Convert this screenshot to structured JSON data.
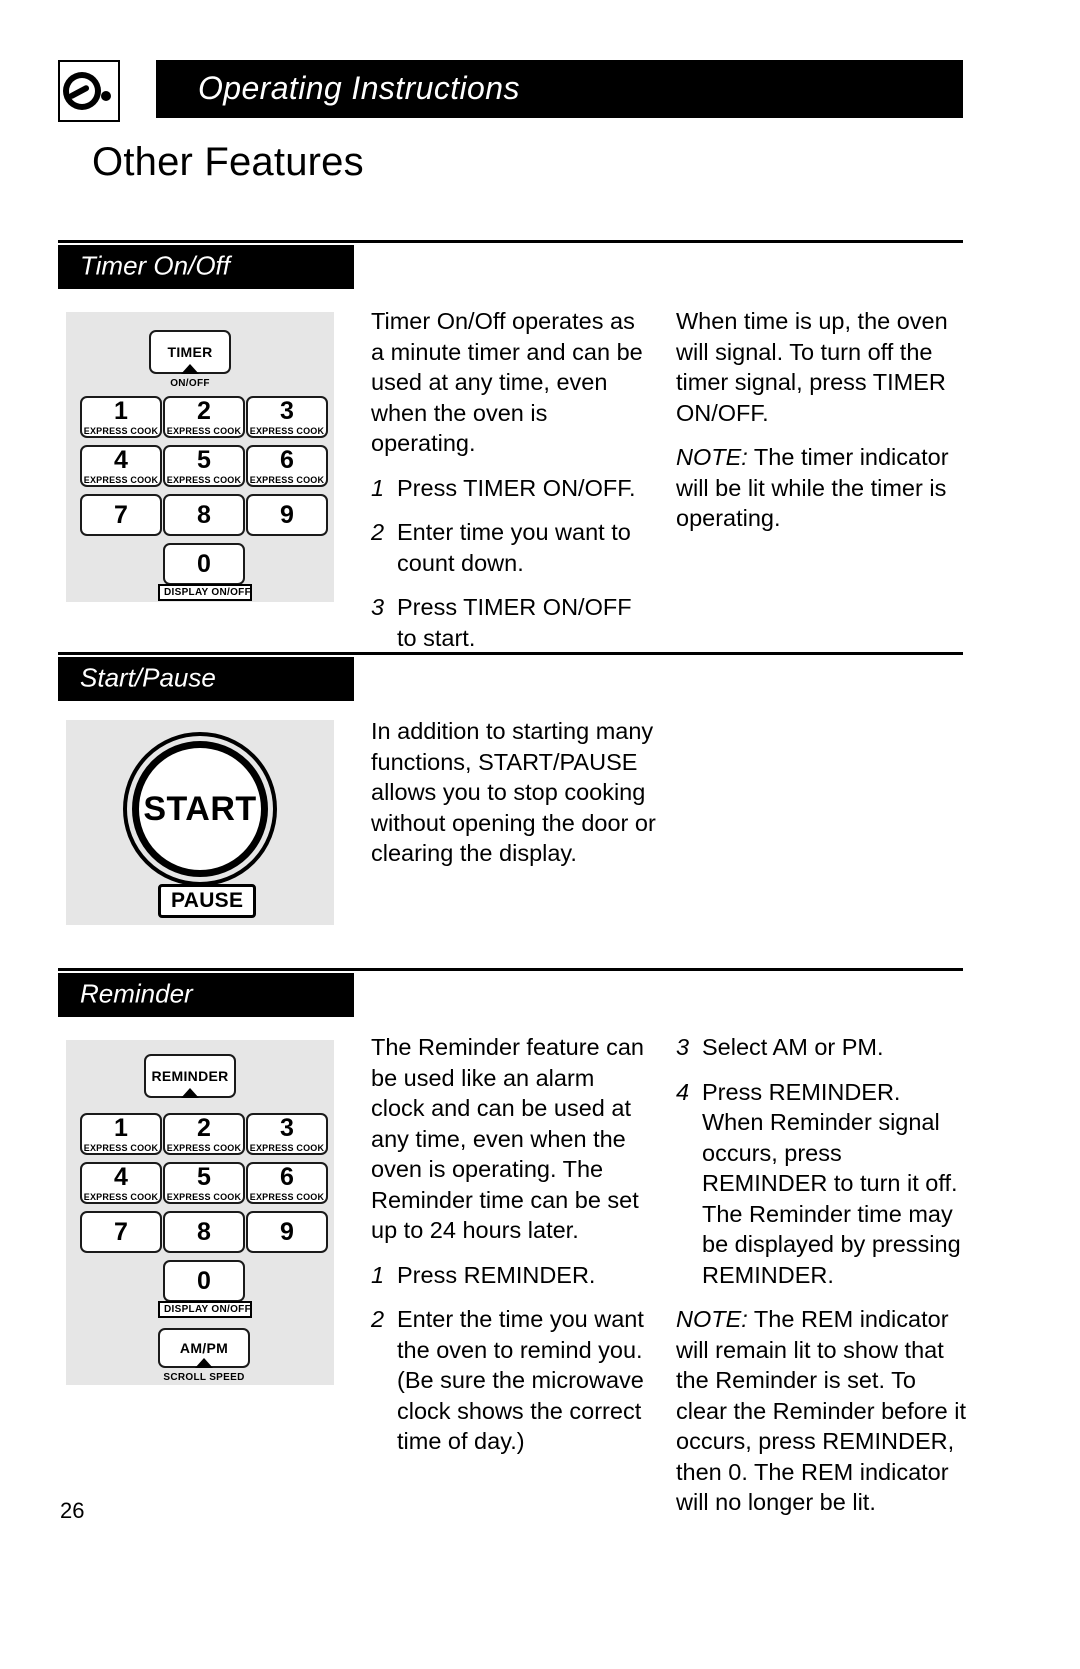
{
  "header": {
    "title": "Operating Instructions",
    "icon": "microwave-dial-icon"
  },
  "page_title": "Other Features",
  "page_number": "26",
  "colors": {
    "bar_background": "#000000",
    "bar_text": "#ffffff",
    "panel_background": "#e6e6e6",
    "page_background": "#ffffff",
    "ink": "#000000"
  },
  "sections": [
    {
      "id": "timer-on-off",
      "heading": "Timer On/Off",
      "keypad": {
        "function_key": {
          "label": "TIMER",
          "under_label": "ON/OFF",
          "has_pointer": true,
          "boxed_under_label": false
        },
        "digit_keys": [
          {
            "digit": "1",
            "sub": "EXPRESS COOK"
          },
          {
            "digit": "2",
            "sub": "EXPRESS COOK"
          },
          {
            "digit": "3",
            "sub": "EXPRESS COOK"
          },
          {
            "digit": "4",
            "sub": "EXPRESS COOK"
          },
          {
            "digit": "5",
            "sub": "EXPRESS COOK"
          },
          {
            "digit": "6",
            "sub": "EXPRESS COOK"
          },
          {
            "digit": "7",
            "sub": ""
          },
          {
            "digit": "8",
            "sub": ""
          },
          {
            "digit": "9",
            "sub": ""
          }
        ],
        "zero_key": {
          "digit": "0",
          "under_label": "DISPLAY ON/OFF",
          "boxed_under_label": true
        }
      },
      "column_middle": {
        "intro": "Timer On/Off operates as a minute timer and can be used at any time, even when the oven is operating.",
        "steps": [
          {
            "num": "1",
            "text": "Press TIMER ON/OFF."
          },
          {
            "num": "2",
            "text": "Enter time you want to count down."
          },
          {
            "num": "3",
            "text": "Press TIMER ON/OFF to start."
          }
        ]
      },
      "column_right": {
        "paragraph": "When time is up, the oven will signal. To turn off the timer signal, press TIMER ON/OFF.",
        "note_label": "NOTE:",
        "note_text": " The timer indicator will be lit while the timer is operating."
      }
    },
    {
      "id": "start-pause",
      "heading": "Start/Pause",
      "art": {
        "button_label": "START",
        "secondary_label": "PAUSE"
      },
      "column_middle": {
        "paragraph": "In addition to starting many functions, START/PAUSE allows you to stop cooking without opening the door or clearing the display."
      }
    },
    {
      "id": "reminder",
      "heading": "Reminder",
      "keypad": {
        "function_key": {
          "label": "REMINDER",
          "under_label": "",
          "has_pointer": true,
          "boxed_under_label": false
        },
        "digit_keys": [
          {
            "digit": "1",
            "sub": "EXPRESS COOK"
          },
          {
            "digit": "2",
            "sub": "EXPRESS COOK"
          },
          {
            "digit": "3",
            "sub": "EXPRESS COOK"
          },
          {
            "digit": "4",
            "sub": "EXPRESS COOK"
          },
          {
            "digit": "5",
            "sub": "EXPRESS COOK"
          },
          {
            "digit": "6",
            "sub": "EXPRESS COOK"
          },
          {
            "digit": "7",
            "sub": ""
          },
          {
            "digit": "8",
            "sub": ""
          },
          {
            "digit": "9",
            "sub": ""
          }
        ],
        "zero_key": {
          "digit": "0",
          "under_label": "DISPLAY ON/OFF",
          "boxed_under_label": true
        },
        "ampm_key": {
          "label": "AM/PM",
          "under_label": "SCROLL SPEED",
          "has_pointer": true
        }
      },
      "column_middle": {
        "intro": "The Reminder feature can be used like an alarm clock and can be used at any time, even when the oven is operating. The Reminder time can be set up to 24 hours later.",
        "steps": [
          {
            "num": "1",
            "text": "Press REMINDER."
          },
          {
            "num": "2",
            "text": "Enter the time you want the oven to remind you. (Be sure the microwave clock shows the correct time of day.)"
          }
        ]
      },
      "column_right": {
        "steps": [
          {
            "num": "3",
            "text": "Select AM or PM."
          },
          {
            "num": "4",
            "text": "Press REMINDER. When Reminder signal occurs, press REMINDER to turn it off. The Reminder time may be displayed by pressing REMINDER."
          }
        ],
        "note_label": "NOTE:",
        "note_text": " The REM indicator will remain lit to show that the Reminder is set. To clear the Reminder before it occurs, press REMINDER, then 0. The REM indicator will no longer be lit."
      }
    }
  ]
}
